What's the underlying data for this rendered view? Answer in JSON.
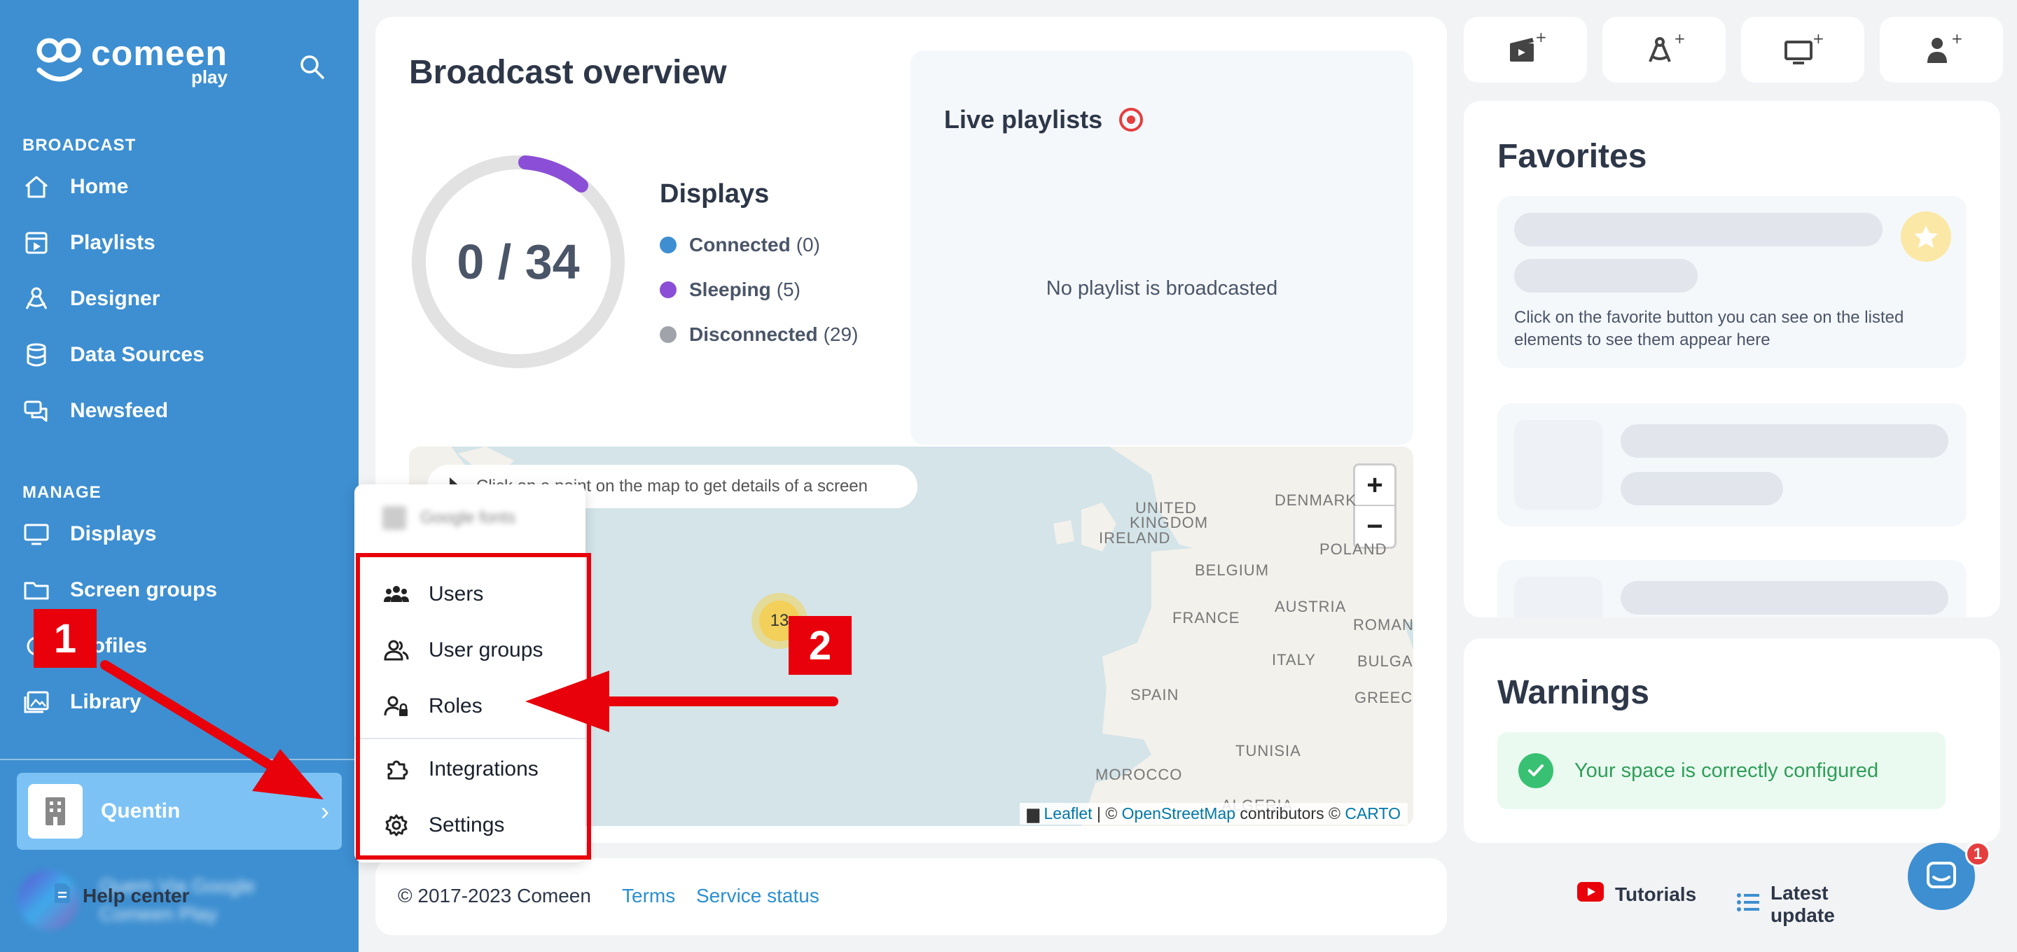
{
  "sidebar": {
    "logo": {
      "name": "comeen",
      "sub": "play"
    },
    "sections": {
      "broadcast": "BROADCAST",
      "manage": "MANAGE"
    },
    "broadcast_items": [
      {
        "label": "Home",
        "icon": "home-icon"
      },
      {
        "label": "Playlists",
        "icon": "playlist-icon"
      },
      {
        "label": "Designer",
        "icon": "designer-icon"
      },
      {
        "label": "Data Sources",
        "icon": "database-icon"
      },
      {
        "label": "Newsfeed",
        "icon": "newsfeed-icon"
      }
    ],
    "manage_items": [
      {
        "label": "Displays",
        "icon": "monitor-icon"
      },
      {
        "label": "Screen groups",
        "icon": "folder-icon"
      },
      {
        "label": "Profiles",
        "icon": "profile-icon"
      },
      {
        "label": "Library",
        "icon": "library-icon"
      }
    ],
    "space": {
      "name": "Quentin"
    },
    "user": {
      "line1": "Quem Via Google",
      "line2": "Comeen Play"
    }
  },
  "overview": {
    "title": "Broadcast overview",
    "donut_label": "0 / 34",
    "displays_title": "Displays",
    "legend": [
      {
        "label": "Connected",
        "count": "(0)",
        "color": "#3d8fd1"
      },
      {
        "label": "Sleeping",
        "count": "(5)",
        "color": "#8a4fd6"
      },
      {
        "label": "Disconnected",
        "count": "(29)",
        "color": "#a0a4aa"
      }
    ],
    "live_title": "Live playlists",
    "live_empty": "No playlist is broadcasted",
    "map": {
      "hint": "Click on a point on the map to get details of a screen",
      "cluster": "13",
      "labels": [
        "UNITED",
        "KINGDOM",
        "IRELAND",
        "DENMARK",
        "BELGIUM",
        "POLAND",
        "FRANCE",
        "AUSTRIA",
        "ROMAN",
        "ITALY",
        "BULGAR",
        "SPAIN",
        "GREECE",
        "TUNISIA",
        "MOROCCO",
        "ALGERIA"
      ],
      "attrib_leaflet": "Leaflet",
      "attrib_sep1": " | © ",
      "attrib_osm": "OpenStreetMap",
      "attrib_mid": " contributors © ",
      "attrib_carto": "CARTO"
    }
  },
  "footer": {
    "copyright": "© 2017-2023 Comeen",
    "terms": "Terms",
    "service_status": "Service status",
    "help_center": "Help center",
    "tutorials": "Tutorials",
    "latest_update": "Latest update"
  },
  "favorites": {
    "title": "Favorites",
    "hint": "Click on the favorite button you can see on the listed elements to see them appear here"
  },
  "warnings": {
    "title": "Warnings",
    "ok": "Your space is correctly configured"
  },
  "popup": {
    "blurred": "Google fonts",
    "items": [
      {
        "label": "Users",
        "icon": "users-icon"
      },
      {
        "label": "User groups",
        "icon": "user-groups-icon"
      },
      {
        "label": "Roles",
        "icon": "roles-icon"
      },
      {
        "label": "Integrations",
        "icon": "puzzle-icon"
      },
      {
        "label": "Settings",
        "icon": "gear-icon"
      }
    ]
  },
  "annotations": {
    "marker1": "1",
    "marker2": "2"
  },
  "chat": {
    "badge": "1"
  },
  "colors": {
    "sidebar": "#3d8fd1",
    "accent_red": "#e8000b",
    "success": "#38c172"
  }
}
